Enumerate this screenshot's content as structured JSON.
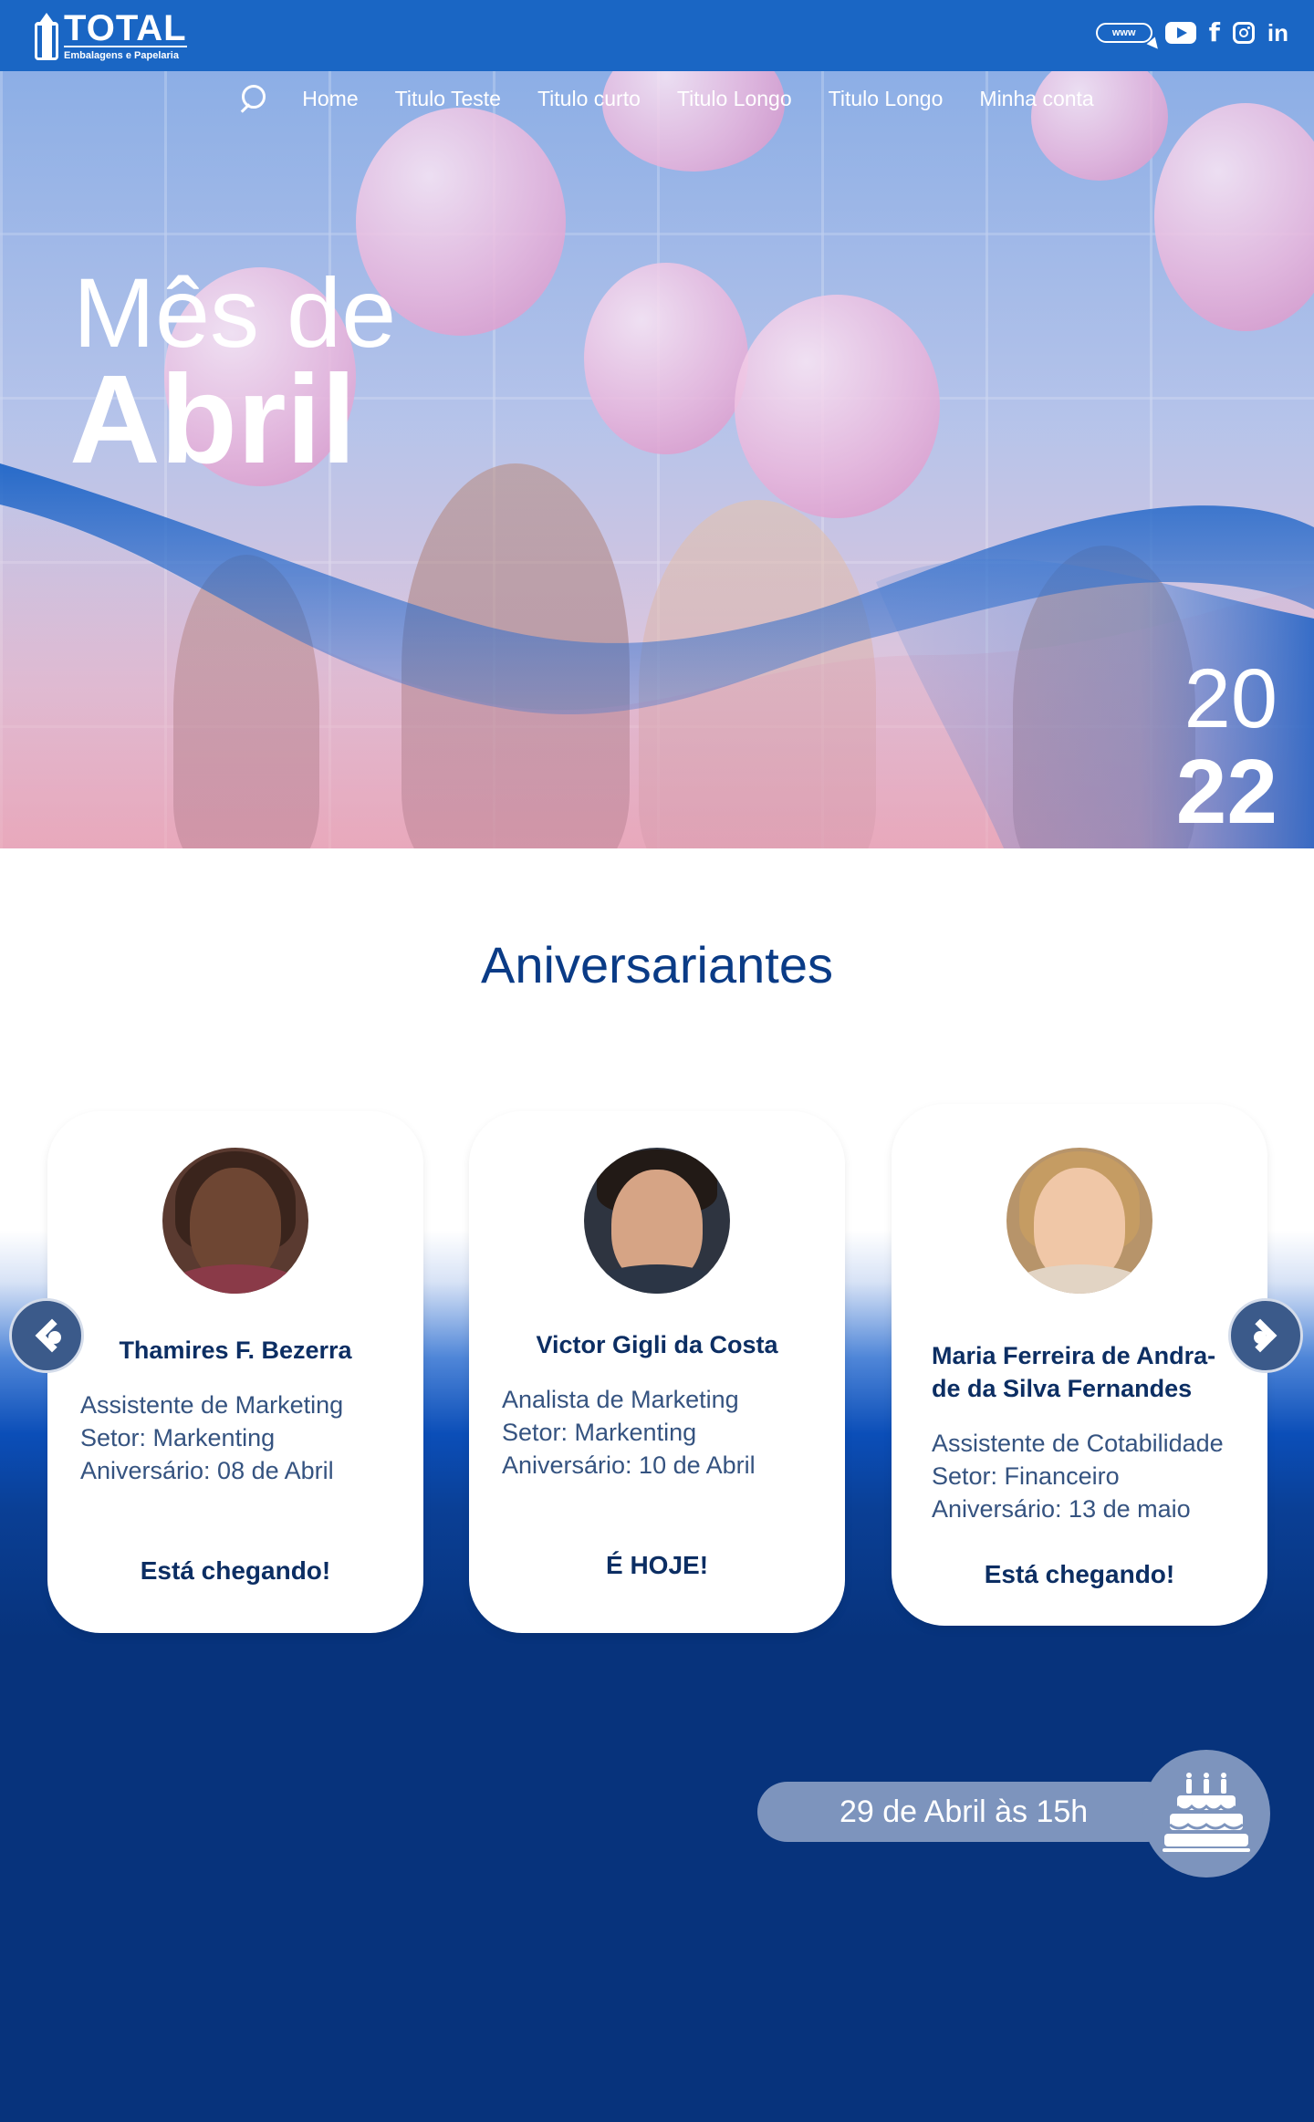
{
  "brand": {
    "name": "TOTAL",
    "tagline": "Embalagens e Papelaria"
  },
  "header": {
    "www_label": "www"
  },
  "nav": {
    "items": [
      "Home",
      "Titulo Teste",
      "Titulo curto",
      "Titulo Longo",
      "Titulo Longo",
      "Minha conta"
    ]
  },
  "hero": {
    "line1": "Mês de",
    "line2": "Abril",
    "year_top": "20",
    "year_bottom": "22"
  },
  "birthdays": {
    "title": "Aniversariantes",
    "cards": [
      {
        "name": "Thamires F. Bezerra",
        "role": "Assistente de Marketing",
        "sector": "Setor: Markenting",
        "birthday": "Aniversário: 08 de Abril",
        "status": "Está chegando!"
      },
      {
        "name": "Victor Gigli da Costa",
        "role": "Analista de Marketing",
        "sector": "Setor: Markenting",
        "birthday": "Aniversário: 10 de Abril",
        "status": "É HOJE!"
      },
      {
        "name_line1": "Maria Ferreira de Andra-",
        "name_line2": "de da Silva Fernandes",
        "role": "Assistente de Cotabilidade",
        "sector": "Setor: Financeiro",
        "birthday": "Aniversário: 13 de maio",
        "status": "Está chegando!"
      }
    ]
  },
  "event": {
    "label": "29 de Abril às 15h"
  },
  "colors": {
    "topbar": "#1a66c4",
    "navy": "#07337c",
    "text_dark": "#0c2e63",
    "pill": "#7d94bd"
  }
}
